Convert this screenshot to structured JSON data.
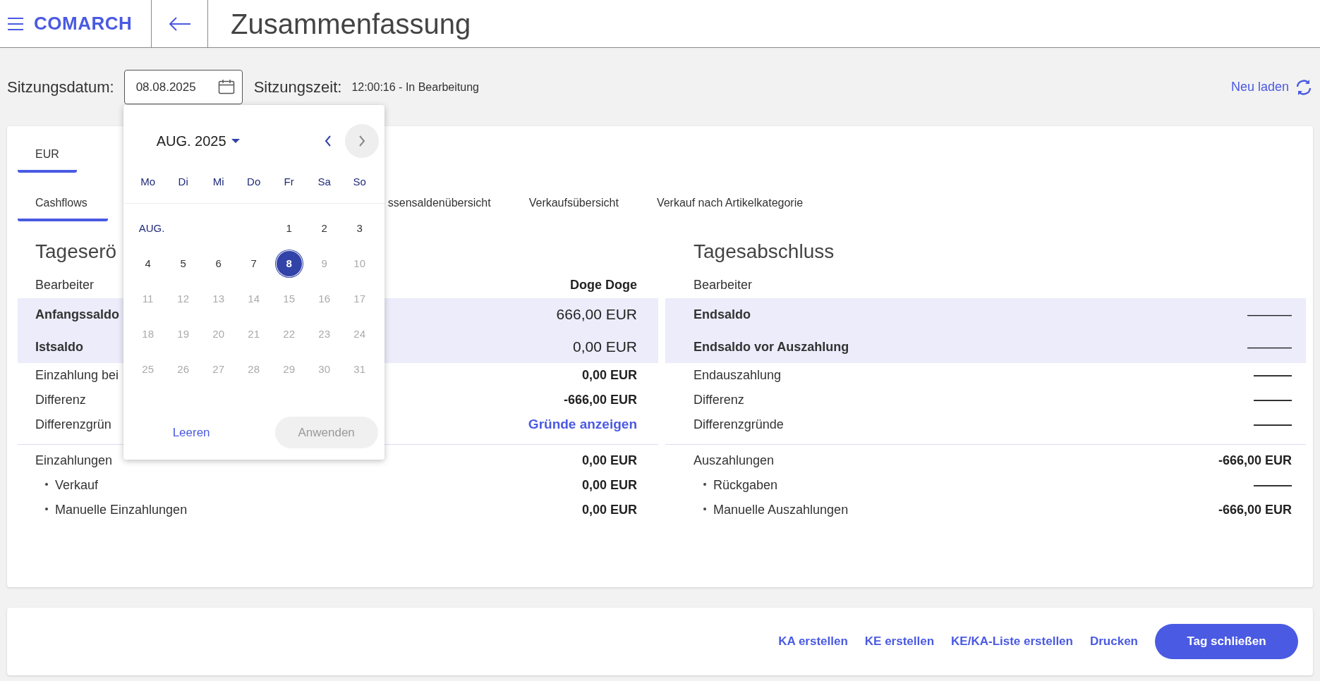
{
  "header": {
    "logo": "COMARCH",
    "title": "Zusammenfassung"
  },
  "session": {
    "date_label": "Sitzungsdatum:",
    "date_value": "08.08.2025",
    "time_label": "Sitzungszeit:",
    "time_value": "12:00:16 - In Bearbeitung",
    "reload": "Neu laden"
  },
  "currency_tabs": [
    {
      "label": "EUR",
      "selected": true
    }
  ],
  "view_tabs": [
    {
      "label": "Cashflows",
      "selected": true
    },
    {
      "label": "ssensaldenübersicht",
      "selected": false
    },
    {
      "label": "Verkaufsübersicht",
      "selected": false
    },
    {
      "label": "Verkauf nach Artikelkategorie",
      "selected": false
    }
  ],
  "opening": {
    "title": "Tageserö",
    "rows": [
      {
        "label": "Bearbeiter",
        "value": "Doge Doge",
        "highlight": false
      },
      {
        "label": "Anfangssaldo",
        "value": "666,00 EUR",
        "highlight": true
      },
      {
        "label": "Istsaldo",
        "value": "0,00 EUR",
        "highlight": true
      },
      {
        "label": "Einzahlung bei",
        "value": "0,00 EUR",
        "highlight": false
      },
      {
        "label": "Differenz",
        "value": "-666,00 EUR",
        "highlight": false
      },
      {
        "label": "Differenzgrün",
        "value": "Gründe anzeigen",
        "highlight": false,
        "value_link": true
      }
    ],
    "flows": [
      {
        "label": "Einzahlungen",
        "value": "0,00 EUR",
        "children": [
          {
            "label": "Verkauf",
            "value": "0,00 EUR"
          },
          {
            "label": "Manuelle Einzahlungen",
            "value": "0,00 EUR"
          }
        ]
      }
    ]
  },
  "closing": {
    "title": "Tagesabschluss",
    "rows": [
      {
        "label": "Bearbeiter",
        "highlight": false
      },
      {
        "label": "Endsaldo",
        "value": "———",
        "highlight": true
      },
      {
        "label": "Endsaldo vor Auszahlung",
        "value": "———",
        "highlight": true
      },
      {
        "label": "Endauszahlung",
        "value": "———",
        "highlight": false
      },
      {
        "label": "Differenz",
        "value": "———",
        "highlight": false
      },
      {
        "label": "Differenzgründe",
        "value": "———",
        "highlight": false
      }
    ],
    "flows": [
      {
        "label": "Auszahlungen",
        "value": "-666,00 EUR",
        "children": [
          {
            "label": "Rückgaben",
            "value": "———"
          },
          {
            "label": "Manuelle Auszahlungen",
            "value": "-666,00 EUR"
          }
        ]
      }
    ]
  },
  "datepicker": {
    "month": "AUG. 2025",
    "prev_disabled": false,
    "next_disabled": true,
    "weekdays": [
      "Mo",
      "Di",
      "Mi",
      "Do",
      "Fr",
      "Sa",
      "So"
    ],
    "month_label": "AUG.",
    "weeks": [
      [
        {
          "day": "1",
          "disabled": false,
          "selected": false
        },
        {
          "day": "2",
          "disabled": false,
          "selected": false
        },
        {
          "day": "3",
          "disabled": false,
          "selected": false
        }
      ],
      [
        {
          "day": "4",
          "disabled": false,
          "selected": false
        },
        {
          "day": "5",
          "disabled": false,
          "selected": false
        },
        {
          "day": "6",
          "disabled": false,
          "selected": false
        },
        {
          "day": "7",
          "disabled": false,
          "selected": false
        },
        {
          "day": "8",
          "disabled": false,
          "selected": true
        },
        {
          "day": "9",
          "disabled": true,
          "selected": false
        },
        {
          "day": "10",
          "disabled": true,
          "selected": false
        }
      ],
      [
        {
          "day": "11",
          "disabled": true,
          "selected": false
        },
        {
          "day": "12",
          "disabled": true,
          "selected": false
        },
        {
          "day": "13",
          "disabled": true,
          "selected": false
        },
        {
          "day": "14",
          "disabled": true,
          "selected": false
        },
        {
          "day": "15",
          "disabled": true,
          "selected": false
        },
        {
          "day": "16",
          "disabled": true,
          "selected": false
        },
        {
          "day": "17",
          "disabled": true,
          "selected": false
        }
      ],
      [
        {
          "day": "18",
          "disabled": true,
          "selected": false
        },
        {
          "day": "19",
          "disabled": true,
          "selected": false
        },
        {
          "day": "20",
          "disabled": true,
          "selected": false
        },
        {
          "day": "21",
          "disabled": true,
          "selected": false
        },
        {
          "day": "22",
          "disabled": true,
          "selected": false
        },
        {
          "day": "23",
          "disabled": true,
          "selected": false
        },
        {
          "day": "24",
          "disabled": true,
          "selected": false
        }
      ],
      [
        {
          "day": "25",
          "disabled": true,
          "selected": false
        },
        {
          "day": "26",
          "disabled": true,
          "selected": false
        },
        {
          "day": "27",
          "disabled": true,
          "selected": false
        },
        {
          "day": "28",
          "disabled": true,
          "selected": false
        },
        {
          "day": "29",
          "disabled": true,
          "selected": false
        },
        {
          "day": "30",
          "disabled": true,
          "selected": false
        },
        {
          "day": "31",
          "disabled": true,
          "selected": false
        }
      ]
    ],
    "clear": "Leeren",
    "apply": "Anwenden",
    "apply_disabled": true
  },
  "footer": {
    "links": [
      "KA erstellen",
      "KE erstellen",
      "KE/KA-Liste erstellen",
      "Drucken"
    ],
    "primary": "Tag schließen"
  }
}
